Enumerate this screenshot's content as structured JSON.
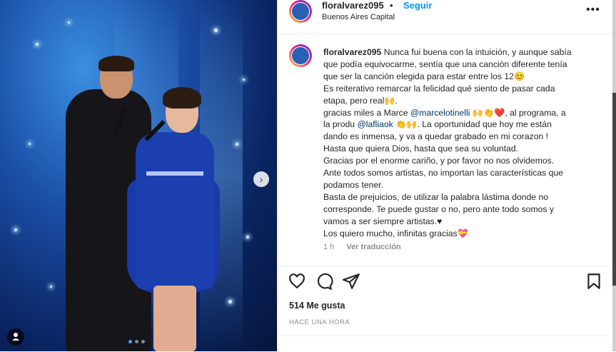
{
  "post": {
    "username": "floralvarez095",
    "separator": "•",
    "follow_label": "Seguir",
    "location": "Buenos Aires Capital",
    "more_label": "•••",
    "caption_lines": [
      "Nunca fui buena con la intuición, y aunque sabía",
      "que podía equivocarme, sentía que una canción diferente tenía",
      "que ser la canción elegida para estar entre los 12😊",
      "Es reiterativo remarcar la felicidad qué siento de pasar cada",
      "etapa, pero real🙌.",
      "gracias miles a Marce ",
      " 🙌👏❤️, al programa, a",
      "la produ ",
      " 👏🙌. La oportunidad que hoy me están",
      "dando es inmensa, y va a quedar grabado en mi corazon !",
      "Hasta que quiera Dios, hasta que sea su voluntad.",
      "Gracias por el enorme cariño, y por favor no nos olvidemos.",
      "Ante todos somos artistas, no importan las características que",
      "podamos tener.",
      "Basta de prejuicios, de utilizar la palabra lástima donde no",
      "corresponde. Te puede gustar o no, pero ante todo somos y",
      "vamos a ser siempre artistas.♥",
      "Los quiero mucho, infinitas gracias💝"
    ],
    "mention1": "@marcelotinelli",
    "mention2": "@lafliaok",
    "time": "1 h",
    "translate_label": "Ver traducción",
    "likes": "514 Me gusta",
    "ago": "HACE UNA HORA"
  },
  "media": {
    "carousel_next": "›",
    "tag_icon": "person-icon"
  }
}
